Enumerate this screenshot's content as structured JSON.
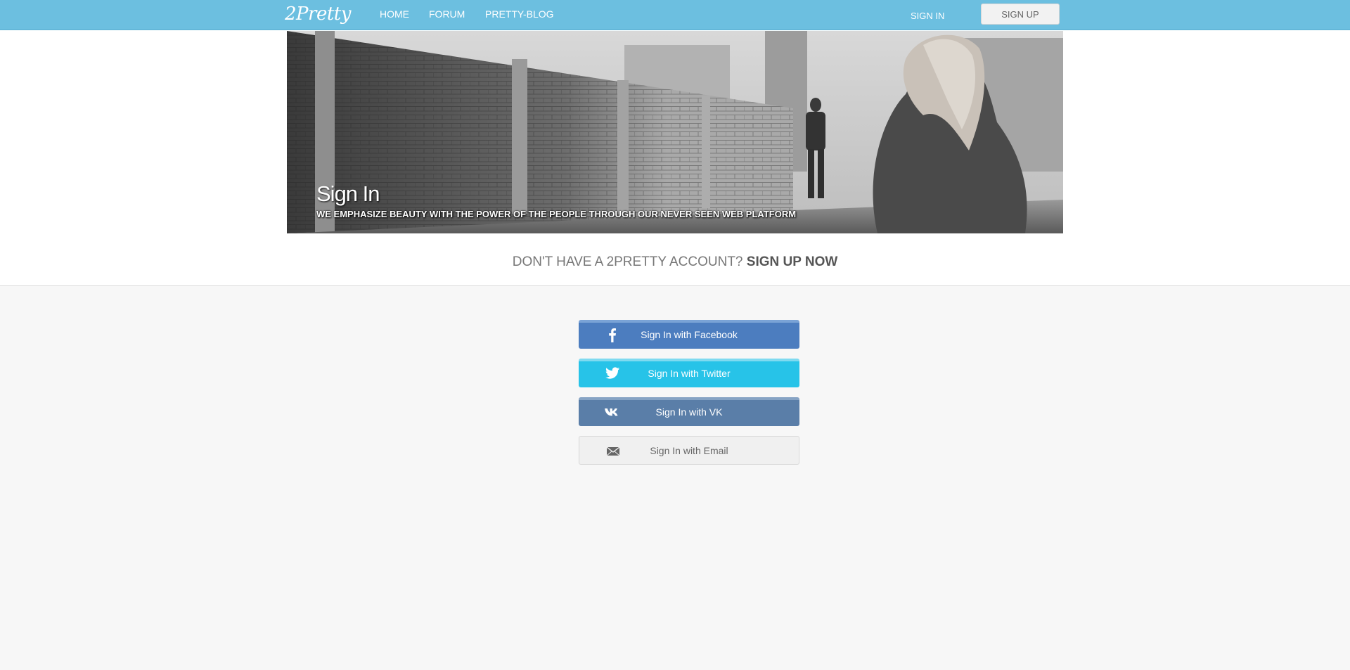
{
  "nav": {
    "logo": "2Pretty",
    "links": [
      "HOME",
      "FORUM",
      "PRETTY-BLOG"
    ],
    "sign_in": "SIGN IN",
    "sign_up": "SIGN UP"
  },
  "hero": {
    "title": "Sign In",
    "subtitle": "WE EMPHASIZE BEAUTY WITH THE POWER OF THE PEOPLE THROUGH OUR NEVER SEEN WEB PLATFORM"
  },
  "cta": {
    "text": "DON'T HAVE A 2PRETTY ACCOUNT?",
    "link": "SIGN UP NOW"
  },
  "social": {
    "facebook": {
      "label": "Sign In with Facebook",
      "icon": "facebook-icon",
      "color": "#4c7dbf"
    },
    "twitter": {
      "label": "Sign In with Twitter",
      "icon": "twitter-icon",
      "color": "#27c3e8"
    },
    "vk": {
      "label": "Sign In with VK",
      "icon": "vk-icon",
      "color": "#5a7ea8"
    },
    "email": {
      "label": "Sign In with Email",
      "icon": "envelope-icon",
      "color": "#f0f0f0"
    }
  },
  "colors": {
    "navbar": "#6cbfe0",
    "page_background": "#f7f7f7"
  }
}
